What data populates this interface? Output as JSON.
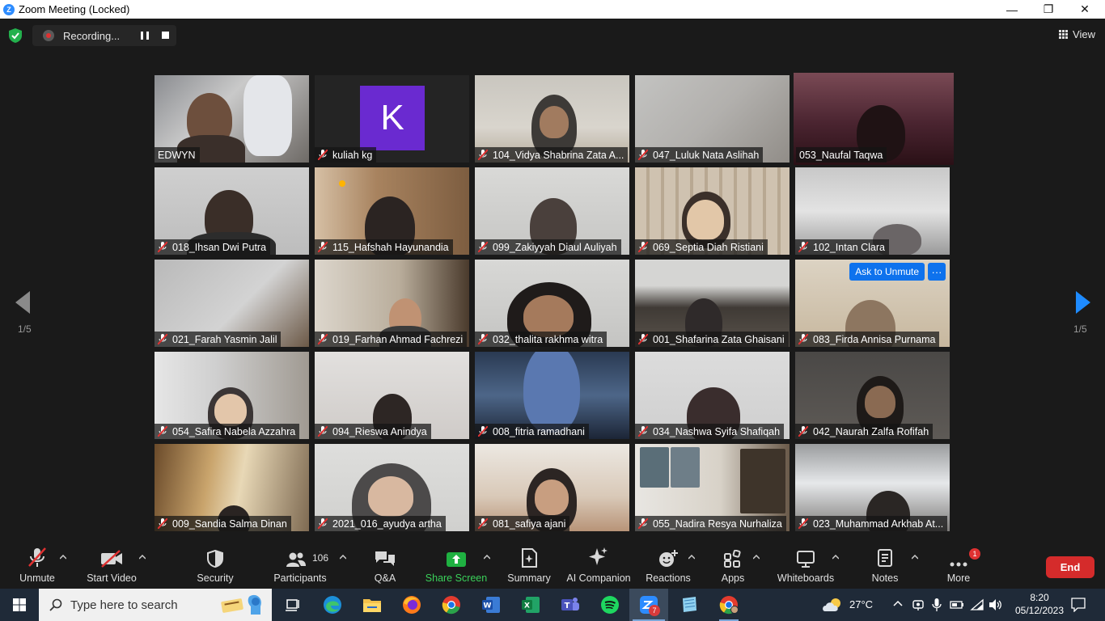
{
  "window": {
    "title": "Zoom Meeting (Locked)",
    "min_glyph": "—",
    "max_glyph": "❐",
    "close_glyph": "✕"
  },
  "meeting_bar": {
    "recording_label": "Recording...",
    "view_label": "View"
  },
  "pagination": {
    "left": "1/5",
    "right": "1/5",
    "arrow_color": "#1e8bff"
  },
  "tiles": [
    {
      "name": "EDWYN",
      "muted": false
    },
    {
      "name": "kuliah kg",
      "muted": true,
      "avatar_letter": "K"
    },
    {
      "name": "104_Vidya Shabrina Zata A...",
      "muted": true
    },
    {
      "name": "047_Luluk Nata Aslihah",
      "muted": true
    },
    {
      "name": "053_Naufal Taqwa",
      "muted": false,
      "active_speaker": true
    },
    {
      "name": "018_Ihsan Dwi Putra",
      "muted": true
    },
    {
      "name": "115_Hafshah Hayunandia",
      "muted": true
    },
    {
      "name": "099_Zakiyyah Diaul Auliyah",
      "muted": true
    },
    {
      "name": "069_Septia Diah Ristiani",
      "muted": true
    },
    {
      "name": "102_Intan Clara",
      "muted": true
    },
    {
      "name": "021_Farah Yasmin Jalil",
      "muted": true
    },
    {
      "name": "019_Farhan Ahmad Fachrezi",
      "muted": true
    },
    {
      "name": "032_thalita rakhma witra",
      "muted": true
    },
    {
      "name": "001_Shafarina Zata Ghaisani",
      "muted": true
    },
    {
      "name": "083_Firda Annisa Purnama",
      "muted": true,
      "hover": {
        "ask_unmute": "Ask to Unmute",
        "more": "···"
      }
    },
    {
      "name": "054_Safira Nabela Azzahra",
      "muted": true
    },
    {
      "name": "094_Rieswa Anindya",
      "muted": true
    },
    {
      "name": "008_fitria ramadhani",
      "muted": true
    },
    {
      "name": "034_Nashwa Syifa Shafiqah",
      "muted": true
    },
    {
      "name": "042_Naurah Zalfa Rofifah",
      "muted": true
    },
    {
      "name": "009_Sandia Salma Dinan",
      "muted": true
    },
    {
      "name": "2021_016_ayudya artha",
      "muted": true
    },
    {
      "name": "081_safiya ajani",
      "muted": true
    },
    {
      "name": "055_Nadira Resya Nurhaliza",
      "muted": true
    },
    {
      "name": "023_Muhammad Arkhab At...",
      "muted": true
    }
  ],
  "toolbar": {
    "unmute": "Unmute",
    "start_video": "Start Video",
    "security": "Security",
    "participants": "Participants",
    "participants_count": "106",
    "qa": "Q&A",
    "share_screen": "Share Screen",
    "summary": "Summary",
    "ai_companion": "AI Companion",
    "reactions": "Reactions",
    "apps": "Apps",
    "whiteboards": "Whiteboards",
    "notes": "Notes",
    "more": "More",
    "more_badge": "1",
    "end": "End"
  },
  "taskbar": {
    "search_placeholder": "Type here to search",
    "weather": "27°C",
    "time": "8:20",
    "date": "05/12/2023",
    "zoom_badge": "7"
  }
}
